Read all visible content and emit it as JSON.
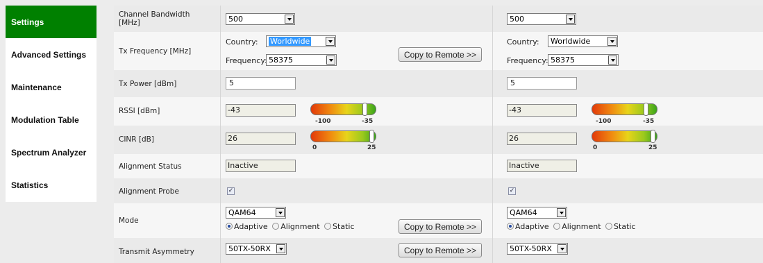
{
  "sidebar": {
    "items": [
      {
        "label": "Settings"
      },
      {
        "label": "Advanced Settings"
      },
      {
        "label": "Maintenance"
      },
      {
        "label": "Modulation Table"
      },
      {
        "label": "Spectrum Analyzer"
      },
      {
        "label": "Statistics"
      }
    ]
  },
  "rows": {
    "channel_bandwidth": {
      "label": "Channel Bandwidth [MHz]",
      "local": "500",
      "remote": "500"
    },
    "tx_frequency": {
      "label": "Tx Frequency [MHz]",
      "country_label": "Country:",
      "frequency_label": "Frequency:",
      "local_country": "Worldwide",
      "local_frequency": "58375",
      "remote_country": "Worldwide",
      "remote_frequency": "58375",
      "copy_button": "Copy to Remote >>"
    },
    "tx_power": {
      "label": "Tx Power [dBm]",
      "local": "5",
      "remote": "5"
    },
    "rssi": {
      "label": "RSSI [dBm]",
      "local": "-43",
      "remote": "-43",
      "gauge_min": "-100",
      "gauge_max": "-35",
      "gauge_level": 0.88
    },
    "cinr": {
      "label": "CINR [dB]",
      "local": "26",
      "remote": "26",
      "gauge_min": "0",
      "gauge_max": "25",
      "gauge_level": 1.0
    },
    "alignment_status": {
      "label": "Alignment Status",
      "local": "Inactive",
      "remote": "Inactive"
    },
    "alignment_probe": {
      "label": "Alignment Probe",
      "local_checked": true,
      "remote_checked": true
    },
    "mode": {
      "label": "Mode",
      "local": "QAM64",
      "remote": "QAM64",
      "options": [
        "Adaptive",
        "Alignment",
        "Static"
      ],
      "selected": "Adaptive",
      "copy_button": "Copy to Remote >>"
    },
    "transmit_asymmetry": {
      "label": "Transmit Asymmetry",
      "local": "50TX-50RX",
      "remote": "50TX-50RX",
      "copy_button": "Copy to Remote >>"
    }
  },
  "colors": {
    "active_menu": "#008000",
    "selection_highlight": "#3399ff"
  }
}
